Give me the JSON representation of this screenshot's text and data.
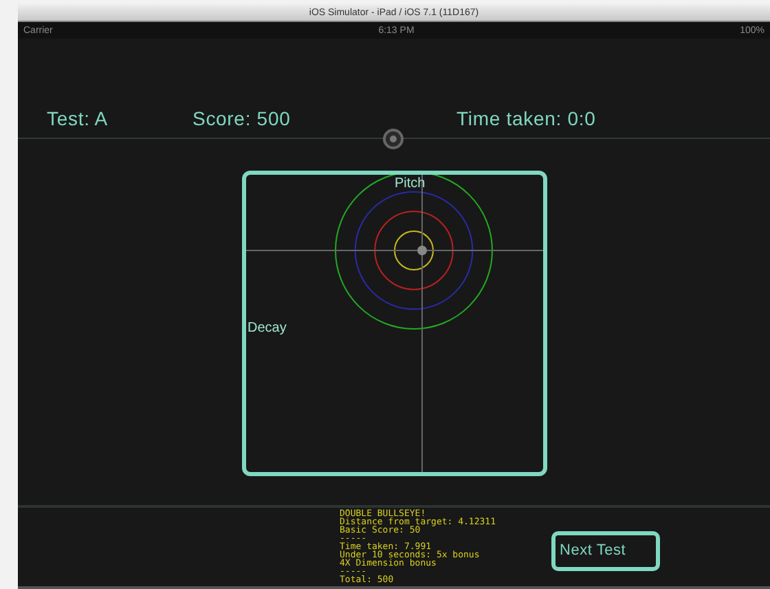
{
  "window": {
    "title": "iOS Simulator - iPad / iOS 7.1 (11D167)"
  },
  "status_bar": {
    "carrier": "Carrier",
    "time": "6:13 PM",
    "battery": "100%"
  },
  "header": {
    "test": "Test: A",
    "score": "Score: 500",
    "time_taken": "Time taken: 0:0"
  },
  "pad": {
    "x_label": "Pitch",
    "y_label": "Decay",
    "rings": [
      {
        "color": "#22aa22"
      },
      {
        "color": "#2a2aaa"
      },
      {
        "color": "#bb2020"
      },
      {
        "color": "#c8b820"
      }
    ]
  },
  "results": [
    "DOUBLE BULLSEYE!",
    "Distance from target: 4.12311",
    "Basic Score: 50",
    "-----",
    "Time taken: 7.991",
    "Under 10 seconds: 5x bonus",
    "4X Dimension bonus",
    "-----",
    "Total: 500"
  ],
  "next_button": "Next Test"
}
